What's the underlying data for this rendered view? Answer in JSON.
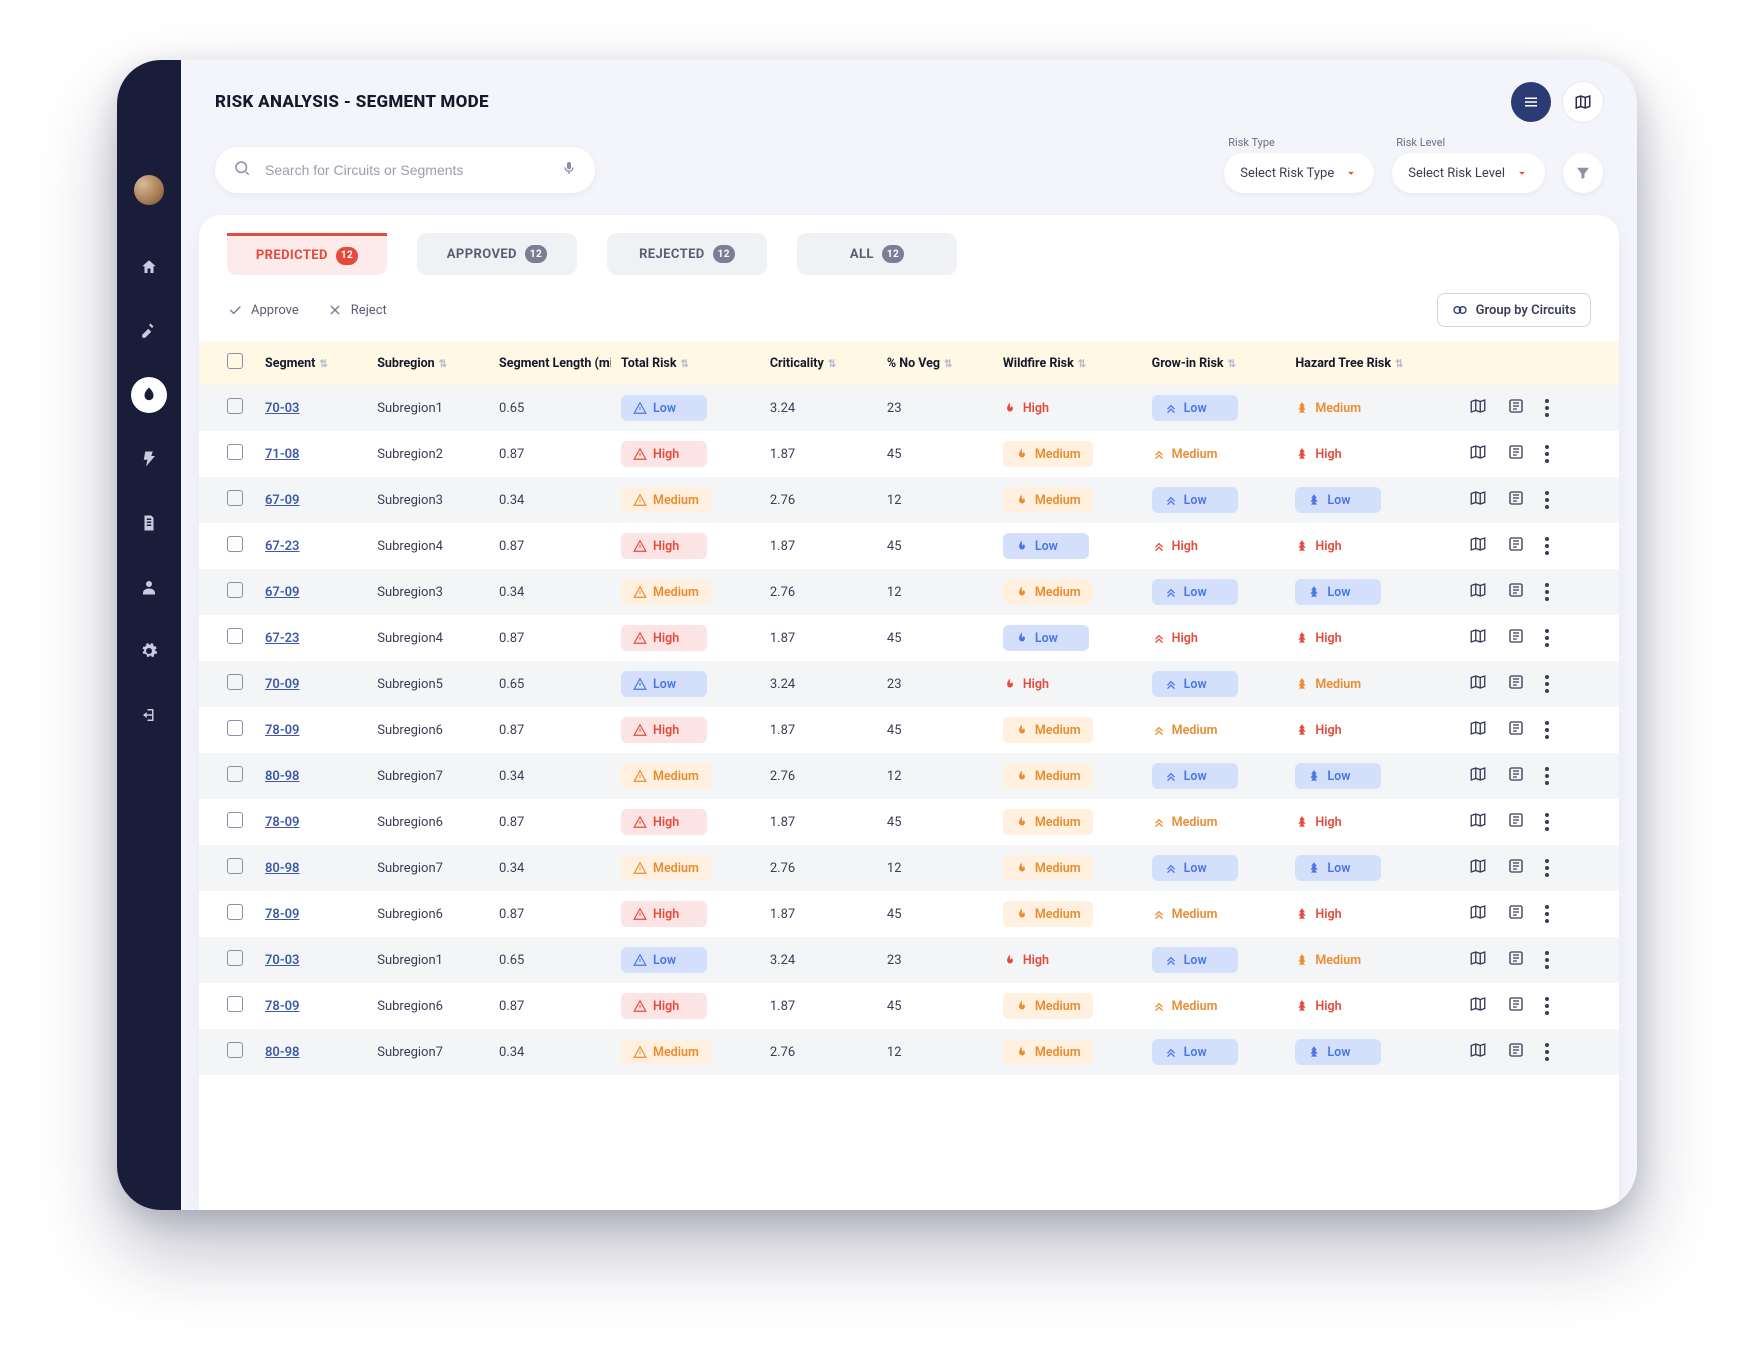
{
  "title": "RISK ANALYSIS - SEGMENT MODE",
  "search": {
    "placeholder": "Search for Circuits or Segments"
  },
  "filters": {
    "risk_type": {
      "label": "Risk Type",
      "value": "Select Risk Type"
    },
    "risk_level": {
      "label": "Risk Level",
      "value": "Select Risk Level"
    }
  },
  "tabs": [
    {
      "label": "PREDICTED",
      "count": "12",
      "active": true
    },
    {
      "label": "APPROVED",
      "count": "12",
      "active": false
    },
    {
      "label": "REJECTED",
      "count": "12",
      "active": false
    },
    {
      "label": "ALL",
      "count": "12",
      "active": false
    }
  ],
  "toolbar": {
    "approve": "Approve",
    "reject": "Reject",
    "group": "Group by Circuits"
  },
  "columns": [
    "Segment",
    "Subregion",
    "Segment Length (mi)",
    "Total Risk",
    "Criticality",
    "% No Veg",
    "Wildfire Risk",
    "Grow-in Risk",
    "Hazard Tree Risk"
  ],
  "rows": [
    {
      "segment": "70-03",
      "subregion": "Subregion1",
      "length": "0.65",
      "total_risk": "Low",
      "criticality": "3.24",
      "no_veg": "23",
      "wildfire": "High",
      "growin": "Low",
      "hazard": "Medium"
    },
    {
      "segment": "71-08",
      "subregion": "Subregion2",
      "length": "0.87",
      "total_risk": "High",
      "criticality": "1.87",
      "no_veg": "45",
      "wildfire": "Medium",
      "growin": "Medium",
      "hazard": "High"
    },
    {
      "segment": "67-09",
      "subregion": "Subregion3",
      "length": "0.34",
      "total_risk": "Medium",
      "criticality": "2.76",
      "no_veg": "12",
      "wildfire": "Medium",
      "growin": "Low",
      "hazard": "Low"
    },
    {
      "segment": "67-23",
      "subregion": "Subregion4",
      "length": "0.87",
      "total_risk": "High",
      "criticality": "1.87",
      "no_veg": "45",
      "wildfire": "Low",
      "growin": "High",
      "hazard": "High"
    },
    {
      "segment": "67-09",
      "subregion": "Subregion3",
      "length": "0.34",
      "total_risk": "Medium",
      "criticality": "2.76",
      "no_veg": "12",
      "wildfire": "Medium",
      "growin": "Low",
      "hazard": "Low"
    },
    {
      "segment": "67-23",
      "subregion": "Subregion4",
      "length": "0.87",
      "total_risk": "High",
      "criticality": "1.87",
      "no_veg": "45",
      "wildfire": "Low",
      "growin": "High",
      "hazard": "High"
    },
    {
      "segment": "70-09",
      "subregion": "Subregion5",
      "length": "0.65",
      "total_risk": "Low",
      "criticality": "3.24",
      "no_veg": "23",
      "wildfire": "High",
      "growin": "Low",
      "hazard": "Medium"
    },
    {
      "segment": "78-09",
      "subregion": "Subregion6",
      "length": "0.87",
      "total_risk": "High",
      "criticality": "1.87",
      "no_veg": "45",
      "wildfire": "Medium",
      "growin": "Medium",
      "hazard": "High"
    },
    {
      "segment": "80-98",
      "subregion": "Subregion7",
      "length": "0.34",
      "total_risk": "Medium",
      "criticality": "2.76",
      "no_veg": "12",
      "wildfire": "Medium",
      "growin": "Low",
      "hazard": "Low"
    },
    {
      "segment": "78-09",
      "subregion": "Subregion6",
      "length": "0.87",
      "total_risk": "High",
      "criticality": "1.87",
      "no_veg": "45",
      "wildfire": "Medium",
      "growin": "Medium",
      "hazard": "High"
    },
    {
      "segment": "80-98",
      "subregion": "Subregion7",
      "length": "0.34",
      "total_risk": "Medium",
      "criticality": "2.76",
      "no_veg": "12",
      "wildfire": "Medium",
      "growin": "Low",
      "hazard": "Low"
    },
    {
      "segment": "78-09",
      "subregion": "Subregion6",
      "length": "0.87",
      "total_risk": "High",
      "criticality": "1.87",
      "no_veg": "45",
      "wildfire": "Medium",
      "growin": "Medium",
      "hazard": "High"
    },
    {
      "segment": "70-03",
      "subregion": "Subregion1",
      "length": "0.65",
      "total_risk": "Low",
      "criticality": "3.24",
      "no_veg": "23",
      "wildfire": "High",
      "growin": "Low",
      "hazard": "Medium"
    },
    {
      "segment": "78-09",
      "subregion": "Subregion6",
      "length": "0.87",
      "total_risk": "High",
      "criticality": "1.87",
      "no_veg": "45",
      "wildfire": "Medium",
      "growin": "Medium",
      "hazard": "High"
    },
    {
      "segment": "80-98",
      "subregion": "Subregion7",
      "length": "0.34",
      "total_risk": "Medium",
      "criticality": "2.76",
      "no_veg": "12",
      "wildfire": "Medium",
      "growin": "Low",
      "hazard": "Low"
    }
  ]
}
